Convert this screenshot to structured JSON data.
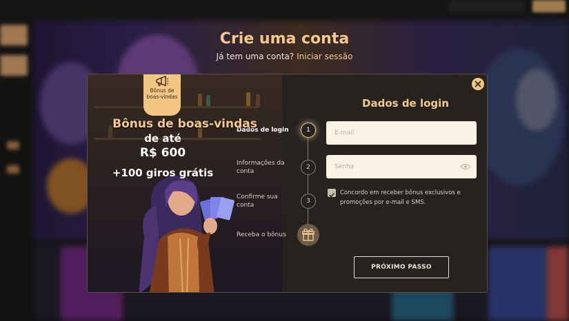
{
  "page": {
    "title": "Crie uma conta",
    "subtitle_prefix": "Já tem uma conta?",
    "login_link": "Iniciar sessão"
  },
  "promo": {
    "badge_label": "Bônus de boas-vindas",
    "badge_icon": "megaphone-icon",
    "title": "Bônus de boas-vindas",
    "up_to": "de até",
    "amount": "R$ 600",
    "spins": "+100 giros grátis"
  },
  "steps": [
    {
      "label": "Dados de login",
      "number": "1",
      "active": true
    },
    {
      "label": "Informações da conta",
      "number": "2",
      "active": false
    },
    {
      "label": "Confirme sua conta",
      "number": "3",
      "active": false
    },
    {
      "label": "Receba o bônus",
      "icon": "gift-icon",
      "active": false
    }
  ],
  "form": {
    "title": "Dados de login",
    "email_placeholder": "E-mail",
    "password_placeholder": "Senha",
    "password_toggle_icon": "eye-icon",
    "consent_text": "Concordo em receber bônus exclusivos e promoções por e-mail e SMS.",
    "consent_checked": true,
    "next_button": "PRÓXIMO PASSO",
    "close_icon": "close-icon"
  },
  "colors": {
    "accent": "#f4c98d",
    "modal_bg": "#252220",
    "input_bg": "#faf2e4"
  }
}
